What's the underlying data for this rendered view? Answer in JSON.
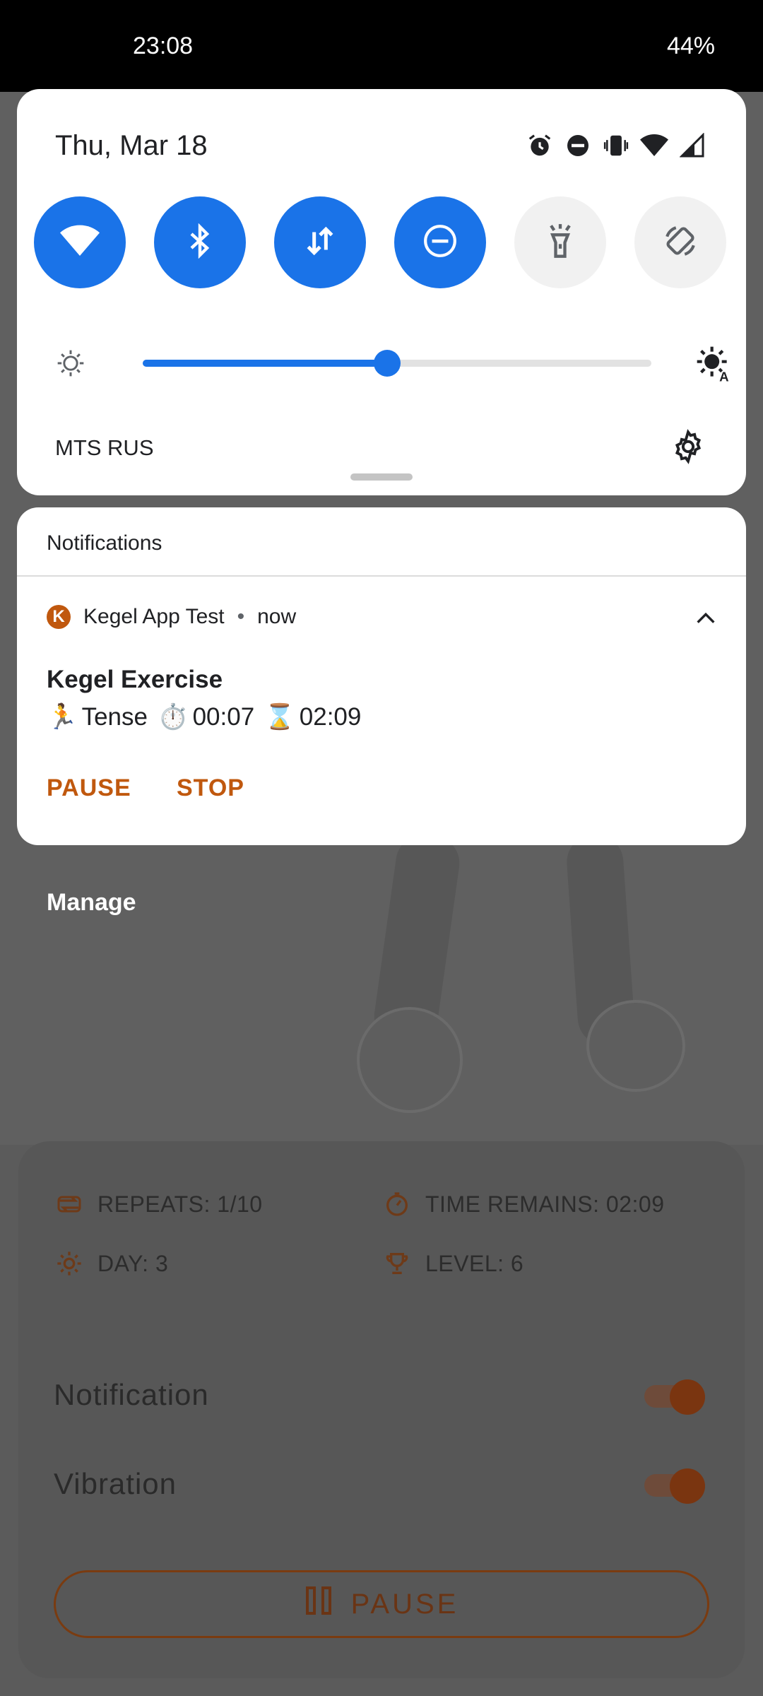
{
  "status_bar": {
    "time": "23:08",
    "battery": "44%"
  },
  "quick_settings": {
    "date": "Thu, Mar 18",
    "status_icons": [
      "alarm-icon",
      "dnd-icon",
      "vibrate-icon",
      "wifi-icon",
      "signal-icon"
    ],
    "tiles": [
      {
        "name": "wifi",
        "icon": "wifi-icon",
        "active": true
      },
      {
        "name": "bluetooth",
        "icon": "bluetooth-icon",
        "active": true
      },
      {
        "name": "mobile-data",
        "icon": "data-arrows-icon",
        "active": true
      },
      {
        "name": "do-not-disturb",
        "icon": "dnd-icon",
        "active": true
      },
      {
        "name": "flashlight",
        "icon": "flashlight-icon",
        "active": false
      },
      {
        "name": "auto-rotate",
        "icon": "rotate-icon",
        "active": false
      }
    ],
    "brightness_level": 0.48,
    "carrier": "MTS RUS",
    "accent_color": "#1a73e8"
  },
  "notifications": {
    "header": "Notifications",
    "items": [
      {
        "app_name": "Kegel App Test",
        "app_badge": "K",
        "time": "now",
        "title": "Kegel Exercise",
        "body": {
          "phase_emoji": "🏃",
          "phase": "Tense",
          "timer_emoji": "⏱️",
          "elapsed": "00:07",
          "hourglass_emoji": "⌛",
          "remaining": "02:09"
        },
        "actions": [
          "PAUSE",
          "STOP"
        ],
        "accent_color": "#c0580e"
      }
    ],
    "manage_label": "Manage"
  },
  "background_app": {
    "stats": {
      "repeats": "REPEATS: 1/10",
      "time_remains": "TIME REMAINS: 02:09",
      "day": "DAY: 3",
      "level": "LEVEL: 6"
    },
    "notification_label": "Notification",
    "vibration_label": "Vibration",
    "notification_on": true,
    "vibration_on": true,
    "pause_label": "PAUSE"
  }
}
